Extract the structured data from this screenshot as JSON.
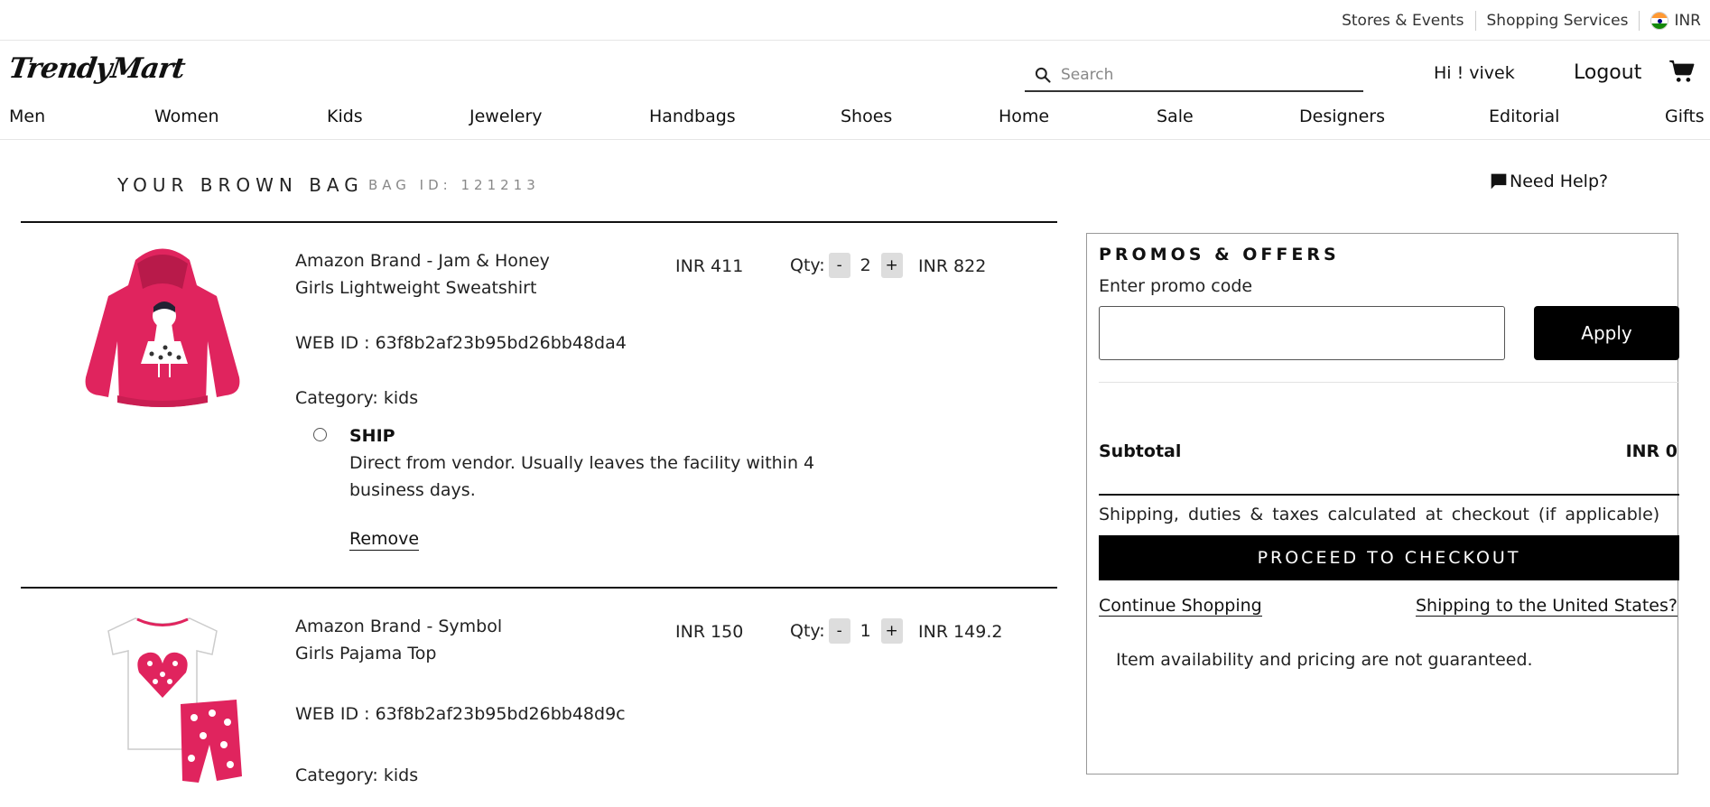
{
  "utility": {
    "links": [
      "Stores & Events",
      "Shopping Services"
    ],
    "currency": "INR"
  },
  "header": {
    "logo": "TrendyMart",
    "search_placeholder": "Search",
    "greeting": "Hi ! vivek",
    "logout": "Logout"
  },
  "nav": [
    "Men",
    "Women",
    "Kids",
    "Jewelery",
    "Handbags",
    "Shoes",
    "Home",
    "Sale",
    "Designers",
    "Editorial",
    "Gifts"
  ],
  "bag": {
    "title": "YOUR BROWN BAG",
    "bag_id": "BAG ID: 121213",
    "need_help": "Need Help?"
  },
  "items": [
    {
      "name_line1": "Amazon Brand - Jam & Honey",
      "name_line2": "Girls Lightweight Sweatshirt",
      "web_id": "WEB ID : 63f8b2af23b95bd26bb48da4",
      "category": "Category: kids",
      "unit_price": "INR 411",
      "qty_label": "Qty:",
      "qty": "2",
      "total": "INR 822",
      "ship_title": "SHIP",
      "ship_desc": "Direct from vendor. Usually leaves the facility within 4 business days.",
      "remove": "Remove"
    },
    {
      "name_line1": "Amazon Brand - Symbol",
      "name_line2": "Girls Pajama Top",
      "web_id": "WEB ID : 63f8b2af23b95bd26bb48d9c",
      "category": "Category: kids",
      "unit_price": "INR 150",
      "qty_label": "Qty:",
      "qty": "1",
      "total": "INR 149.2"
    }
  ],
  "promo": {
    "title": "PROMOS & OFFERS",
    "label": "Enter promo code",
    "input_value": "",
    "apply": "Apply",
    "subtotal_label": "Subtotal",
    "subtotal_value": "INR 0",
    "tax_note": "Shipping, duties & taxes calculated at checkout (if applicable)",
    "checkout": "PROCEED TO CHECKOUT",
    "continue": "Continue Shopping",
    "ship_us": "Shipping to the United States?",
    "availability": "Item availability and pricing are not guaranteed."
  },
  "colors": {
    "primary": "#000000",
    "sweatshirt": "#e0245e",
    "qty_button": "#dddddd"
  }
}
